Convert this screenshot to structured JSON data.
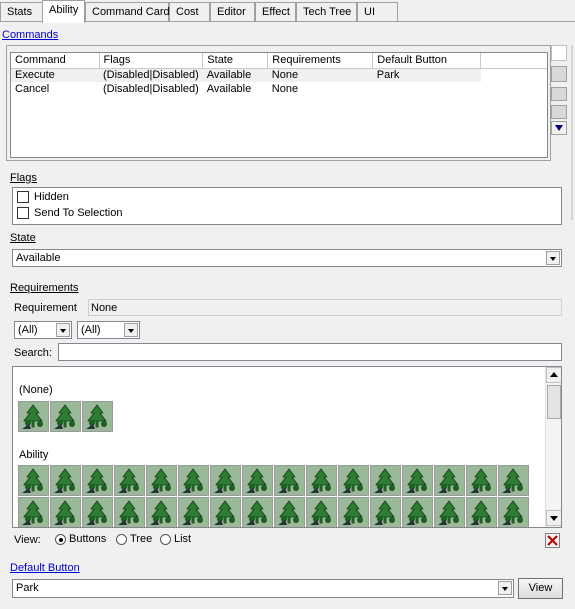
{
  "tabs": [
    "Stats",
    "Ability",
    "Command Card",
    "Cost",
    "Editor",
    "Effect",
    "Tech Tree",
    "UI"
  ],
  "active_tab": "Ability",
  "commands": {
    "label": "Commands",
    "columns": [
      "Command",
      "Flags",
      "State",
      "Requirements",
      "Default Button"
    ],
    "rows": [
      [
        "Execute",
        "(Disabled|Disabled)",
        "Available",
        "None",
        "Park"
      ],
      [
        "Cancel",
        "(Disabled|Disabled)",
        "Available",
        "None",
        ""
      ]
    ]
  },
  "flags": {
    "label": "Flags",
    "items": [
      "Hidden",
      "Send To Selection"
    ]
  },
  "state": {
    "label": "State",
    "value": "Available"
  },
  "requirements": {
    "label": "Requirements",
    "requirement_label": "Requirement",
    "requirement_value": "None",
    "filter1": "(All)",
    "filter2": "(All)",
    "search_label": "Search:",
    "search_value": "",
    "groups": [
      {
        "name": "(None)",
        "count": 3
      },
      {
        "name": "Ability",
        "count": 16
      }
    ]
  },
  "view": {
    "label": "View:",
    "options": [
      "Buttons",
      "Tree",
      "List"
    ],
    "selected": "Buttons"
  },
  "default_button": {
    "label": "Default Button",
    "value": "Park",
    "view_button": "View"
  },
  "colors": {
    "link": "#0000cc",
    "icon_green": "#2e7d32",
    "icon_bg": "#9bb89b"
  }
}
